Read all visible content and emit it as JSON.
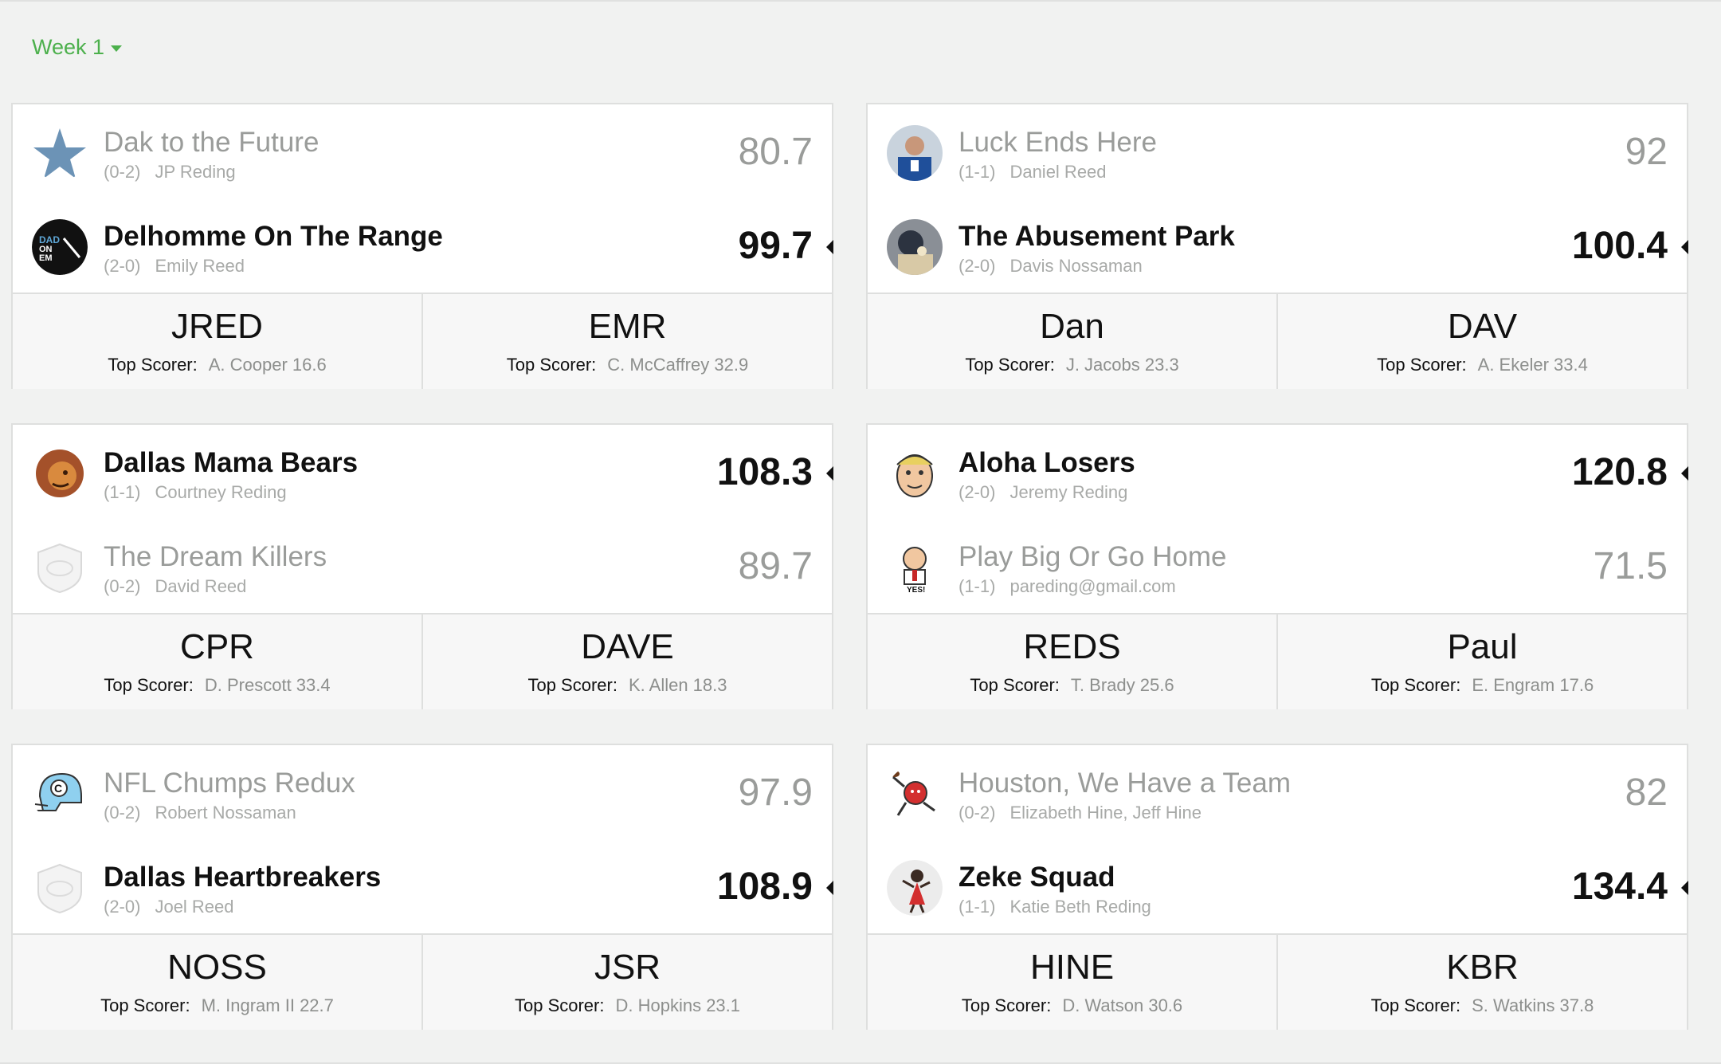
{
  "week_selector": {
    "label": "Week 1"
  },
  "top_scorer_label": "Top Scorer:",
  "matchups": [
    {
      "teams": [
        {
          "name": "Dak to the Future",
          "record": "(0-2)",
          "owner": "JP Reding",
          "score": "80.7",
          "winner": false,
          "avatar": "star-logo"
        },
        {
          "name": "Delhomme On The Range",
          "record": "(2-0)",
          "owner": "Emily Reed",
          "score": "99.7",
          "winner": true,
          "avatar": "dad-on-em-logo"
        }
      ],
      "abbrs": [
        {
          "abbr": "JRED",
          "top": "A. Cooper 16.6"
        },
        {
          "abbr": "EMR",
          "top": "C. McCaffrey 32.9"
        }
      ]
    },
    {
      "teams": [
        {
          "name": "Luck Ends Here",
          "record": "(1-1)",
          "owner": "Daniel Reed",
          "score": "92",
          "winner": false,
          "avatar": "player-photo"
        },
        {
          "name": "The Abusement Park",
          "record": "(2-0)",
          "owner": "Davis Nossaman",
          "score": "100.4",
          "winner": true,
          "avatar": "player-photo-2"
        }
      ],
      "abbrs": [
        {
          "abbr": "Dan",
          "top": "J. Jacobs 23.3"
        },
        {
          "abbr": "DAV",
          "top": "A. Ekeler 33.4"
        }
      ]
    },
    {
      "teams": [
        {
          "name": "Dallas Mama Bears",
          "record": "(1-1)",
          "owner": "Courtney Reding",
          "score": "108.3",
          "winner": true,
          "avatar": "lion-logo"
        },
        {
          "name": "The Dream Killers",
          "record": "(0-2)",
          "owner": "David Reed",
          "score": "89.7",
          "winner": false,
          "avatar": "default-shield-logo"
        }
      ],
      "abbrs": [
        {
          "abbr": "CPR",
          "top": "D. Prescott 33.4"
        },
        {
          "abbr": "DAVE",
          "top": "K. Allen 18.3"
        }
      ]
    },
    {
      "teams": [
        {
          "name": "Aloha Losers",
          "record": "(2-0)",
          "owner": "Jeremy Reding",
          "score": "120.8",
          "winner": true,
          "avatar": "cartoon-face"
        },
        {
          "name": "Play Big Or Go Home",
          "record": "(1-1)",
          "owner": "pareding@gmail.com",
          "score": "71.5",
          "winner": false,
          "avatar": "cartoon-yes"
        }
      ],
      "abbrs": [
        {
          "abbr": "REDS",
          "top": "T. Brady 25.6"
        },
        {
          "abbr": "Paul",
          "top": "E. Engram 17.6"
        }
      ]
    },
    {
      "teams": [
        {
          "name": "NFL Chumps Redux",
          "record": "(0-2)",
          "owner": "Robert Nossaman",
          "score": "97.9",
          "winner": false,
          "avatar": "helmet-logo"
        },
        {
          "name": "Dallas Heartbreakers",
          "record": "(2-0)",
          "owner": "Joel Reed",
          "score": "108.9",
          "winner": true,
          "avatar": "default-shield-logo"
        }
      ],
      "abbrs": [
        {
          "abbr": "NOSS",
          "top": "M. Ingram II 22.7"
        },
        {
          "abbr": "JSR",
          "top": "D. Hopkins 23.1"
        }
      ]
    },
    {
      "teams": [
        {
          "name": "Houston, We Have a Team",
          "record": "(0-2)",
          "owner": "Elizabeth Hine, Jeff Hine",
          "score": "82",
          "winner": false,
          "avatar": "cartoon-red"
        },
        {
          "name": "Zeke Squad",
          "record": "(1-1)",
          "owner": "Katie Beth Reding",
          "score": "134.4",
          "winner": true,
          "avatar": "cartoon-dancer"
        }
      ],
      "abbrs": [
        {
          "abbr": "HINE",
          "top": "D. Watson 30.6"
        },
        {
          "abbr": "KBR",
          "top": "S. Watkins 37.8"
        }
      ]
    }
  ],
  "colors": {
    "accent": "#4cb04c",
    "winner_text": "#111111",
    "loser_text": "#9a9c9a"
  }
}
